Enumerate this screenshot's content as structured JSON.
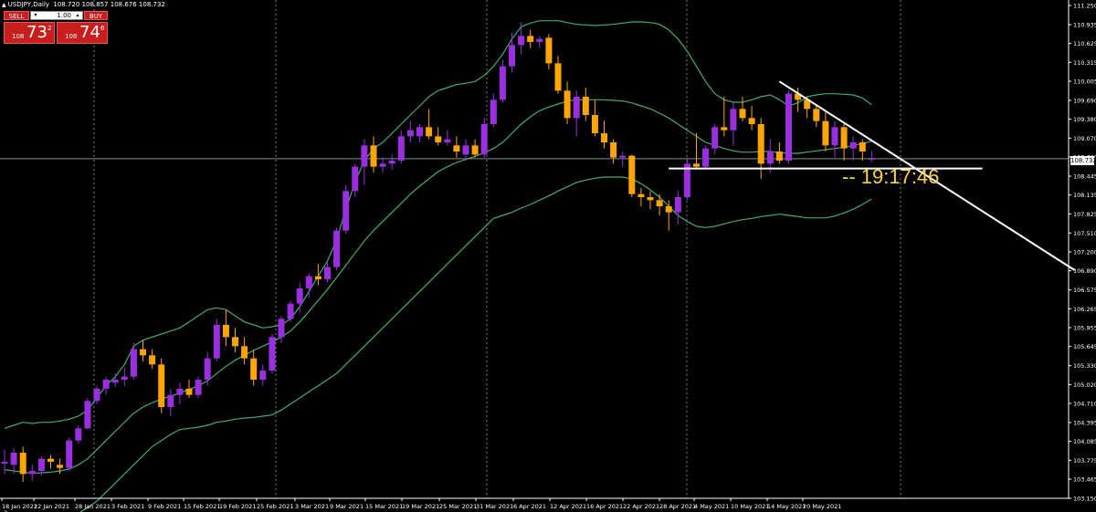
{
  "header": {
    "symbol": "USDJPY,Daily",
    "ohlc": "108.720 108.857 108.676 108.732"
  },
  "trade_panel": {
    "sell_label": "SELL",
    "buy_label": "BUY",
    "lot_value": "1.00",
    "lot_down": "▾",
    "lot_up": "▴",
    "sell_prefix": "108",
    "sell_big": "73",
    "sell_sup": "2",
    "buy_prefix": "108",
    "buy_big": "74",
    "buy_sup": "6"
  },
  "current_price_label": "108.732",
  "countdown": "-- 19:17:46",
  "colors": {
    "bull": "#9a2fe0",
    "bear": "#ffa500",
    "band": "#3fae6e",
    "axis": "#ffffff",
    "grid": "#7f7f7f",
    "countdown": "#ffd24a",
    "sell_buy": "#c81e1e"
  },
  "chart_data": {
    "type": "candlestick",
    "symbol": "USDJPY",
    "timeframe": "Daily",
    "ylim": [
      103.15,
      111.25
    ],
    "y_ticks": [
      "111.250",
      "110.935",
      "110.625",
      "110.315",
      "110.005",
      "109.690",
      "109.380",
      "109.070",
      "108.760",
      "108.445",
      "108.135",
      "107.825",
      "107.510",
      "107.200",
      "106.890",
      "106.575",
      "106.265",
      "105.955",
      "105.645",
      "105.330",
      "105.020",
      "104.710",
      "104.395",
      "104.085",
      "103.775",
      "103.465",
      "103.150"
    ],
    "x_labels": [
      "18 Jan 2021",
      "22 Jan 2021",
      "28 Jan 2021",
      "3 Feb 2021",
      "9 Feb 2021",
      "15 Feb 2021",
      "19 Feb 2021",
      "25 Feb 2021",
      "3 Mar 2021",
      "9 Mar 2021",
      "15 Mar 2021",
      "19 Mar 2021",
      "25 Mar 2021",
      "31 Mar 2021",
      "6 Apr 2021",
      "12 Apr 2021",
      "16 Apr 2021",
      "22 Apr 2021",
      "28 Apr 2021",
      "4 May 2021",
      "10 May 2021",
      "14 May 2021",
      "20 May 2021"
    ],
    "candles": [
      {
        "o": 103.72,
        "h": 103.95,
        "l": 103.55,
        "c": 103.75
      },
      {
        "o": 103.7,
        "h": 103.98,
        "l": 103.55,
        "c": 103.9
      },
      {
        "o": 103.9,
        "h": 104.0,
        "l": 103.42,
        "c": 103.55
      },
      {
        "o": 103.55,
        "h": 103.7,
        "l": 103.44,
        "c": 103.6
      },
      {
        "o": 103.6,
        "h": 103.84,
        "l": 103.52,
        "c": 103.8
      },
      {
        "o": 103.8,
        "h": 103.86,
        "l": 103.64,
        "c": 103.75
      },
      {
        "o": 103.7,
        "h": 103.8,
        "l": 103.55,
        "c": 103.65
      },
      {
        "o": 103.65,
        "h": 104.15,
        "l": 103.6,
        "c": 104.1
      },
      {
        "o": 104.1,
        "h": 104.35,
        "l": 104.05,
        "c": 104.3
      },
      {
        "o": 104.3,
        "h": 104.8,
        "l": 104.28,
        "c": 104.75
      },
      {
        "o": 104.75,
        "h": 105.0,
        "l": 104.7,
        "c": 104.95
      },
      {
        "o": 104.95,
        "h": 105.15,
        "l": 104.85,
        "c": 105.1
      },
      {
        "o": 105.05,
        "h": 105.2,
        "l": 104.98,
        "c": 105.1
      },
      {
        "o": 105.1,
        "h": 105.3,
        "l": 105.0,
        "c": 105.15
      },
      {
        "o": 105.15,
        "h": 105.7,
        "l": 105.1,
        "c": 105.6
      },
      {
        "o": 105.6,
        "h": 105.75,
        "l": 105.4,
        "c": 105.5
      },
      {
        "o": 105.5,
        "h": 105.6,
        "l": 105.28,
        "c": 105.35
      },
      {
        "o": 105.35,
        "h": 105.45,
        "l": 104.55,
        "c": 104.65
      },
      {
        "o": 104.65,
        "h": 104.95,
        "l": 104.5,
        "c": 104.85
      },
      {
        "o": 104.85,
        "h": 105.05,
        "l": 104.7,
        "c": 104.95
      },
      {
        "o": 104.95,
        "h": 105.1,
        "l": 104.8,
        "c": 104.85
      },
      {
        "o": 104.85,
        "h": 105.15,
        "l": 104.8,
        "c": 105.1
      },
      {
        "o": 105.1,
        "h": 105.55,
        "l": 105.0,
        "c": 105.45
      },
      {
        "o": 105.45,
        "h": 106.1,
        "l": 105.4,
        "c": 106.0
      },
      {
        "o": 106.0,
        "h": 106.25,
        "l": 105.65,
        "c": 105.8
      },
      {
        "o": 105.8,
        "h": 105.95,
        "l": 105.55,
        "c": 105.65
      },
      {
        "o": 105.65,
        "h": 105.8,
        "l": 105.35,
        "c": 105.45
      },
      {
        "o": 105.45,
        "h": 105.6,
        "l": 105.0,
        "c": 105.1
      },
      {
        "o": 105.1,
        "h": 105.35,
        "l": 105.0,
        "c": 105.25
      },
      {
        "o": 105.25,
        "h": 105.85,
        "l": 105.2,
        "c": 105.8
      },
      {
        "o": 105.8,
        "h": 106.15,
        "l": 105.7,
        "c": 106.1
      },
      {
        "o": 106.1,
        "h": 106.4,
        "l": 106.05,
        "c": 106.35
      },
      {
        "o": 106.35,
        "h": 106.7,
        "l": 106.2,
        "c": 106.6
      },
      {
        "o": 106.6,
        "h": 106.85,
        "l": 106.45,
        "c": 106.8
      },
      {
        "o": 106.8,
        "h": 107.0,
        "l": 106.65,
        "c": 106.75
      },
      {
        "o": 106.75,
        "h": 107.05,
        "l": 106.7,
        "c": 106.95
      },
      {
        "o": 106.95,
        "h": 107.6,
        "l": 106.9,
        "c": 107.55
      },
      {
        "o": 107.55,
        "h": 108.3,
        "l": 107.5,
        "c": 108.2
      },
      {
        "o": 108.2,
        "h": 108.65,
        "l": 108.1,
        "c": 108.6
      },
      {
        "o": 108.6,
        "h": 109.05,
        "l": 108.3,
        "c": 108.95
      },
      {
        "o": 108.95,
        "h": 109.1,
        "l": 108.5,
        "c": 108.6
      },
      {
        "o": 108.6,
        "h": 108.75,
        "l": 108.5,
        "c": 108.65
      },
      {
        "o": 108.65,
        "h": 108.8,
        "l": 108.55,
        "c": 108.7
      },
      {
        "o": 108.7,
        "h": 109.2,
        "l": 108.65,
        "c": 109.1
      },
      {
        "o": 109.1,
        "h": 109.35,
        "l": 109.0,
        "c": 109.2
      },
      {
        "o": 109.1,
        "h": 109.3,
        "l": 109.0,
        "c": 109.25
      },
      {
        "o": 109.25,
        "h": 109.55,
        "l": 109.05,
        "c": 109.1
      },
      {
        "o": 109.1,
        "h": 109.25,
        "l": 108.95,
        "c": 109.0
      },
      {
        "o": 109.0,
        "h": 109.2,
        "l": 108.95,
        "c": 109.05
      },
      {
        "o": 108.95,
        "h": 109.1,
        "l": 108.75,
        "c": 108.85
      },
      {
        "o": 108.8,
        "h": 109.05,
        "l": 108.7,
        "c": 108.95
      },
      {
        "o": 108.95,
        "h": 109.05,
        "l": 108.75,
        "c": 108.8
      },
      {
        "o": 108.8,
        "h": 109.4,
        "l": 108.75,
        "c": 109.3
      },
      {
        "o": 109.3,
        "h": 109.8,
        "l": 109.25,
        "c": 109.7
      },
      {
        "o": 109.7,
        "h": 110.35,
        "l": 109.65,
        "c": 110.25
      },
      {
        "o": 110.25,
        "h": 110.8,
        "l": 110.15,
        "c": 110.6
      },
      {
        "o": 110.6,
        "h": 110.97,
        "l": 110.45,
        "c": 110.75
      },
      {
        "o": 110.75,
        "h": 110.85,
        "l": 110.55,
        "c": 110.65
      },
      {
        "o": 110.65,
        "h": 110.75,
        "l": 110.55,
        "c": 110.7
      },
      {
        "o": 110.72,
        "h": 110.78,
        "l": 110.2,
        "c": 110.3
      },
      {
        "o": 110.3,
        "h": 110.42,
        "l": 109.8,
        "c": 109.85
      },
      {
        "o": 109.85,
        "h": 110.0,
        "l": 109.3,
        "c": 109.4
      },
      {
        "o": 109.4,
        "h": 109.85,
        "l": 109.1,
        "c": 109.75
      },
      {
        "o": 109.75,
        "h": 109.9,
        "l": 109.35,
        "c": 109.45
      },
      {
        "o": 109.45,
        "h": 109.7,
        "l": 109.1,
        "c": 109.15
      },
      {
        "o": 109.15,
        "h": 109.35,
        "l": 108.9,
        "c": 109.0
      },
      {
        "o": 109.0,
        "h": 109.05,
        "l": 108.65,
        "c": 108.75
      },
      {
        "o": 108.75,
        "h": 108.85,
        "l": 108.6,
        "c": 108.78
      },
      {
        "o": 108.78,
        "h": 108.8,
        "l": 108.1,
        "c": 108.15
      },
      {
        "o": 108.15,
        "h": 108.25,
        "l": 107.95,
        "c": 108.1
      },
      {
        "o": 108.1,
        "h": 108.2,
        "l": 107.9,
        "c": 108.05
      },
      {
        "o": 108.05,
        "h": 108.15,
        "l": 107.8,
        "c": 107.95
      },
      {
        "o": 107.95,
        "h": 108.05,
        "l": 107.55,
        "c": 107.85
      },
      {
        "o": 107.85,
        "h": 108.2,
        "l": 107.65,
        "c": 108.1
      },
      {
        "o": 108.1,
        "h": 108.75,
        "l": 108.05,
        "c": 108.65
      },
      {
        "o": 108.65,
        "h": 109.15,
        "l": 108.55,
        "c": 108.6
      },
      {
        "o": 108.6,
        "h": 108.95,
        "l": 108.55,
        "c": 108.9
      },
      {
        "o": 108.9,
        "h": 109.3,
        "l": 108.8,
        "c": 109.25
      },
      {
        "o": 109.25,
        "h": 109.75,
        "l": 109.1,
        "c": 109.2
      },
      {
        "o": 109.2,
        "h": 109.65,
        "l": 108.95,
        "c": 109.55
      },
      {
        "o": 109.55,
        "h": 109.75,
        "l": 109.35,
        "c": 109.4
      },
      {
        "o": 109.4,
        "h": 109.6,
        "l": 109.2,
        "c": 109.3
      },
      {
        "o": 109.3,
        "h": 109.4,
        "l": 108.4,
        "c": 108.65
      },
      {
        "o": 108.65,
        "h": 109.05,
        "l": 108.5,
        "c": 108.85
      },
      {
        "o": 108.85,
        "h": 109.0,
        "l": 108.65,
        "c": 108.7
      },
      {
        "o": 108.7,
        "h": 109.85,
        "l": 108.65,
        "c": 109.8
      },
      {
        "o": 109.8,
        "h": 109.9,
        "l": 109.5,
        "c": 109.7
      },
      {
        "o": 109.7,
        "h": 109.75,
        "l": 109.4,
        "c": 109.55
      },
      {
        "o": 109.55,
        "h": 109.6,
        "l": 109.25,
        "c": 109.35
      },
      {
        "o": 109.35,
        "h": 109.5,
        "l": 108.85,
        "c": 108.95
      },
      {
        "o": 108.95,
        "h": 109.35,
        "l": 108.75,
        "c": 109.25
      },
      {
        "o": 109.25,
        "h": 109.3,
        "l": 108.7,
        "c": 108.9
      },
      {
        "o": 108.9,
        "h": 109.1,
        "l": 108.7,
        "c": 109.0
      },
      {
        "o": 109.0,
        "h": 109.05,
        "l": 108.7,
        "c": 108.85
      },
      {
        "o": 108.72,
        "h": 108.86,
        "l": 108.68,
        "c": 108.73
      }
    ],
    "bollinger": {
      "upper": [
        104.3,
        104.35,
        104.4,
        104.38,
        104.4,
        104.4,
        104.42,
        104.45,
        104.5,
        104.6,
        104.8,
        105.0,
        105.15,
        105.35,
        105.65,
        105.75,
        105.8,
        105.85,
        105.9,
        105.95,
        106.05,
        106.15,
        106.25,
        106.28,
        106.25,
        106.15,
        106.05,
        106.0,
        105.95,
        105.97,
        106.0,
        106.1,
        106.3,
        106.55,
        106.8,
        107.05,
        107.4,
        107.9,
        108.35,
        108.7,
        108.9,
        109.0,
        109.15,
        109.3,
        109.45,
        109.6,
        109.75,
        109.85,
        109.9,
        109.95,
        109.97,
        110.0,
        110.1,
        110.25,
        110.45,
        110.7,
        110.9,
        110.96,
        111.0,
        111.0,
        111.0,
        110.97,
        110.94,
        110.93,
        110.92,
        110.93,
        110.94,
        110.96,
        110.98,
        110.98,
        110.97,
        110.94,
        110.85,
        110.7,
        110.5,
        110.25,
        110.0,
        109.8,
        109.7,
        109.66,
        109.66,
        109.7,
        109.75,
        109.78,
        109.7,
        109.6,
        109.65,
        109.75,
        109.78,
        109.8,
        109.8,
        109.79,
        109.78,
        109.73,
        109.62
      ],
      "middle": [
        103.62,
        103.6,
        103.58,
        103.56,
        103.57,
        103.58,
        103.6,
        103.63,
        103.7,
        103.8,
        103.95,
        104.1,
        104.25,
        104.4,
        104.55,
        104.65,
        104.72,
        104.78,
        104.83,
        104.88,
        104.94,
        105.0,
        105.08,
        105.2,
        105.32,
        105.42,
        105.5,
        105.58,
        105.65,
        105.72,
        105.8,
        105.9,
        106.05,
        106.22,
        106.4,
        106.58,
        106.78,
        106.98,
        107.18,
        107.38,
        107.55,
        107.7,
        107.85,
        108.0,
        108.15,
        108.28,
        108.4,
        108.52,
        108.6,
        108.67,
        108.72,
        108.77,
        108.83,
        108.9,
        109.0,
        109.15,
        109.3,
        109.42,
        109.52,
        109.58,
        109.63,
        109.68,
        109.7,
        109.7,
        109.7,
        109.7,
        109.69,
        109.68,
        109.65,
        109.6,
        109.55,
        109.48,
        109.4,
        109.3,
        109.2,
        109.1,
        109.0,
        108.95,
        108.9,
        108.86,
        108.84,
        108.84,
        108.85,
        108.85,
        108.83,
        108.82,
        108.82,
        108.84,
        108.86,
        108.88,
        108.9,
        108.92,
        108.95,
        108.98,
        109.02
      ],
      "lower": [
        102.95,
        102.85,
        102.75,
        102.7,
        102.65,
        102.7,
        102.75,
        102.8,
        102.9,
        103.0,
        103.1,
        103.25,
        103.4,
        103.55,
        103.7,
        103.85,
        104.0,
        104.1,
        104.2,
        104.28,
        104.3,
        104.32,
        104.35,
        104.4,
        104.42,
        104.45,
        104.47,
        104.48,
        104.5,
        104.52,
        104.6,
        104.7,
        104.8,
        104.9,
        105.0,
        105.1,
        105.2,
        105.35,
        105.5,
        105.65,
        105.8,
        105.95,
        106.1,
        106.25,
        106.4,
        106.55,
        106.7,
        106.85,
        107.0,
        107.15,
        107.3,
        107.45,
        107.6,
        107.75,
        107.8,
        107.85,
        107.92,
        107.98,
        108.05,
        108.12,
        108.2,
        108.27,
        108.34,
        108.38,
        108.41,
        108.43,
        108.43,
        108.43,
        108.4,
        108.32,
        108.22,
        108.1,
        107.95,
        107.8,
        107.7,
        107.62,
        107.6,
        107.62,
        107.66,
        107.7,
        107.73,
        107.75,
        107.78,
        107.8,
        107.82,
        107.8,
        107.78,
        107.76,
        107.76,
        107.76,
        107.79,
        107.84,
        107.9,
        107.98,
        108.07
      ]
    },
    "trendlines": [
      {
        "name": "descending resistance",
        "x1": 84,
        "y1": 110.0,
        "x2": 116,
        "y2": 106.9
      },
      {
        "name": "horizontal support",
        "x1": 72,
        "y1": 108.57,
        "x2": 106,
        "y2": 108.57
      }
    ],
    "bid": 108.732
  }
}
